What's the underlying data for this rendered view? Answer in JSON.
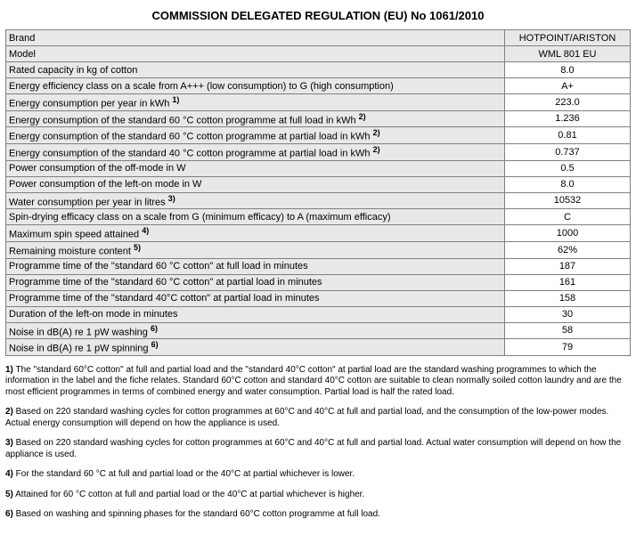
{
  "title": "COMMISSION DELEGATED REGULATION (EU) No 1061/2010",
  "rows": [
    {
      "label": "Brand",
      "value": "HOTPOINT/ARISTON",
      "head": true,
      "sup": ""
    },
    {
      "label": "Model",
      "value": "WML 801 EU",
      "head": true,
      "sup": ""
    },
    {
      "label": "Rated capacity in kg of cotton",
      "value": "8.0",
      "sup": ""
    },
    {
      "label": "Energy efficiency class on a scale from A+++ (low consumption) to G (high consumption)",
      "value": "A+",
      "sup": ""
    },
    {
      "label": "Energy consumption per year in kWh ",
      "value": "223.0",
      "sup": "1)"
    },
    {
      "label": "Energy consumption of the standard 60 °C cotton programme at full load in kWh ",
      "value": "1.236",
      "sup": "2)"
    },
    {
      "label": "Energy consumption of the standard 60 °C cotton programme at partial load in kWh ",
      "value": "0.81",
      "sup": "2)"
    },
    {
      "label": "Energy consumption of the standard 40 °C cotton programme at partial load in kWh ",
      "value": "0.737",
      "sup": "2)"
    },
    {
      "label": "Power consumption of the off-mode in W",
      "value": "0.5",
      "sup": ""
    },
    {
      "label": "Power consumption of the left-on mode in W",
      "value": "8.0",
      "sup": ""
    },
    {
      "label": "Water consumption per year in litres ",
      "value": "10532",
      "sup": "3)"
    },
    {
      "label": "Spin-drying efficacy class on a scale from G (minimum efficacy) to A (maximum efficacy)",
      "value": "C",
      "sup": ""
    },
    {
      "label": "Maximum spin speed attained ",
      "value": "1000",
      "sup": "4)"
    },
    {
      "label": "Remaining moisture content ",
      "value": "62%",
      "sup": "5)"
    },
    {
      "label": "Programme time of the \"standard 60 °C cotton\" at full load in minutes",
      "value": "187",
      "sup": ""
    },
    {
      "label": "Programme time of the \"standard 60 °C cotton\" at partial load in minutes",
      "value": "161",
      "sup": ""
    },
    {
      "label": "Programme time of the \"standard 40°C cotton\" at partial load in minutes",
      "value": "158",
      "sup": ""
    },
    {
      "label": "Duration of the left-on mode in minutes",
      "value": "30",
      "sup": ""
    },
    {
      "label": "Noise in dB(A) re 1 pW washing ",
      "value": "58",
      "sup": "6)"
    },
    {
      "label": "Noise in dB(A) re 1 pW spinning ",
      "value": "79",
      "sup": "6)"
    }
  ],
  "footnotes": [
    {
      "num": "1)",
      "text": "The \"standard 60°C cotton\" at full and partial load and the \"standard 40°C cotton\" at partial load are the standard washing programmes to which the information in the label and the fiche relates. Standard 60°C cotton and standard 40°C cotton are suitable to clean normally soiled cotton laundry and are the most efficient programmes in terms of combined energy and water consumption. Partial load is half the rated load."
    },
    {
      "num": "2)",
      "text": "Based on 220 standard washing cycles for cotton programmes at 60°C and 40°C at full and partial load, and the consumption of the low-power modes. Actual energy consumption will depend on how the appliance is used."
    },
    {
      "num": "3)",
      "text": "Based on 220 standard washing cycles for cotton programmes at 60°C and 40°C at full and partial load. Actual water consumption will depend on how the appliance is used."
    },
    {
      "num": "4)",
      "text": "For the standard 60 °C at full and partial load or the 40°C at partial whichever is lower."
    },
    {
      "num": "5)",
      "text": "Attained for 60 °C cotton at full and partial load or the 40°C at partial whichever is higher."
    },
    {
      "num": "6)",
      "text": "Based on washing and spinning phases for the standard 60°C cotton programme at full load."
    }
  ]
}
